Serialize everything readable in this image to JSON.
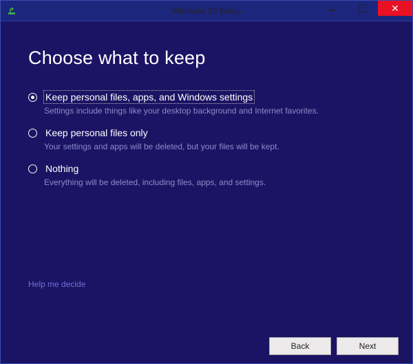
{
  "titlebar": {
    "title": "Windows 10 Setup"
  },
  "heading": "Choose what to keep",
  "options": [
    {
      "label": "Keep personal files, apps, and Windows settings",
      "description": "Settings include things like your desktop background and Internet favorites.",
      "checked": true,
      "focused": true
    },
    {
      "label": "Keep personal files only",
      "description": "Your settings and apps will be deleted, but your files will be kept.",
      "checked": false,
      "focused": false
    },
    {
      "label": "Nothing",
      "description": "Everything will be deleted, including files, apps, and settings.",
      "checked": false,
      "focused": false
    }
  ],
  "help_link": "Help me decide",
  "buttons": {
    "back": "Back",
    "next": "Next"
  },
  "colors": {
    "window_bg": "#1b1464",
    "titlebar_bg": "#1d267d",
    "close_bg": "#e81123",
    "desc_text": "#8a8cc9",
    "link": "#7070d8"
  }
}
